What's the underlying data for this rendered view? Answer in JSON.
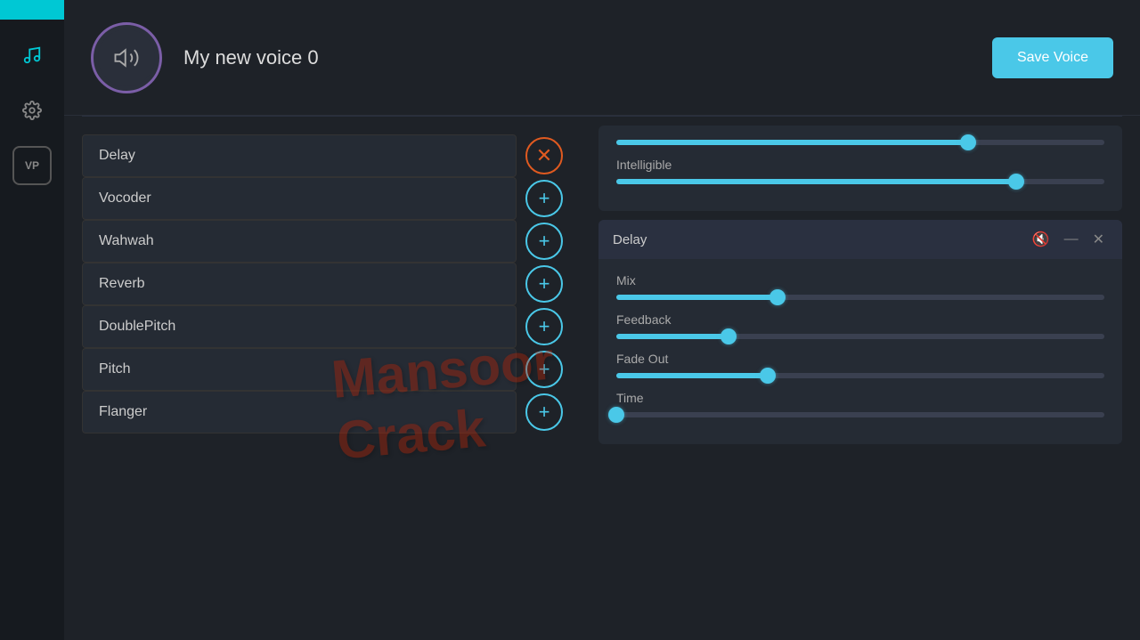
{
  "sidebar": {
    "items": [
      {
        "id": "music",
        "icon": "♪",
        "label": "Music",
        "active": true
      },
      {
        "id": "settings",
        "icon": "⚙",
        "label": "Settings",
        "active": false
      },
      {
        "id": "vp",
        "icon": "VP",
        "label": "Voice Profile",
        "active": false
      }
    ]
  },
  "header": {
    "voice_name": "My new voice 0",
    "save_button_label": "Save Voice",
    "avatar_icon": "🔊"
  },
  "effects_list": [
    {
      "name": "Delay",
      "action": "remove",
      "id": "delay"
    },
    {
      "name": "Vocoder",
      "action": "add",
      "id": "vocoder"
    },
    {
      "name": "Wahwah",
      "action": "add",
      "id": "wahwah"
    },
    {
      "name": "Reverb",
      "action": "add",
      "id": "reverb"
    },
    {
      "name": "DoublePitch",
      "action": "add",
      "id": "doublepitch"
    },
    {
      "name": "Pitch",
      "action": "add",
      "id": "pitch"
    },
    {
      "name": "Flanger",
      "action": "add",
      "id": "flanger"
    }
  ],
  "vocoder_panel": {
    "sliders": [
      {
        "id": "slider1",
        "fill_pct": 72,
        "label": ""
      },
      {
        "id": "intelligible",
        "fill_pct": 82,
        "label": "Intelligible"
      }
    ]
  },
  "delay_panel": {
    "title": "Delay",
    "mute_icon": "🔇",
    "minimize_icon": "—",
    "close_icon": "✕",
    "sliders": [
      {
        "id": "mix",
        "label": "Mix",
        "fill_pct": 33
      },
      {
        "id": "feedback",
        "label": "Feedback",
        "fill_pct": 23
      },
      {
        "id": "fade_out",
        "label": "Fade Out",
        "fill_pct": 31
      },
      {
        "id": "time",
        "label": "Time",
        "fill_pct": 0
      }
    ]
  }
}
